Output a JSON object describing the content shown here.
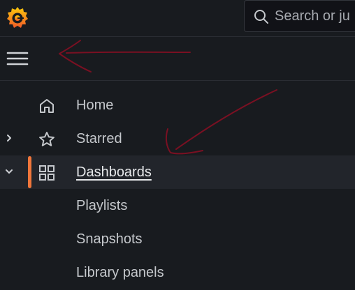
{
  "header": {
    "logo_icon": "grafana-logo-icon",
    "search": {
      "icon": "search-icon",
      "placeholder": "Search or ju"
    }
  },
  "menu": {
    "icon": "hamburger-menu-icon"
  },
  "nav": {
    "items": [
      {
        "label": "Home",
        "icon": "home-icon",
        "expandable": false,
        "active": false
      },
      {
        "label": "Starred",
        "icon": "star-icon",
        "expandable": true,
        "expanded": false,
        "active": false
      },
      {
        "label": "Dashboards",
        "icon": "dashboards-grid-icon",
        "expandable": true,
        "expanded": true,
        "active": true
      }
    ],
    "subitems": [
      {
        "label": "Playlists"
      },
      {
        "label": "Snapshots"
      },
      {
        "label": "Library panels"
      }
    ]
  },
  "colors": {
    "background": "#181b1f",
    "active_accent": "#f0763b",
    "annotation_arrow": "#7a1022"
  }
}
